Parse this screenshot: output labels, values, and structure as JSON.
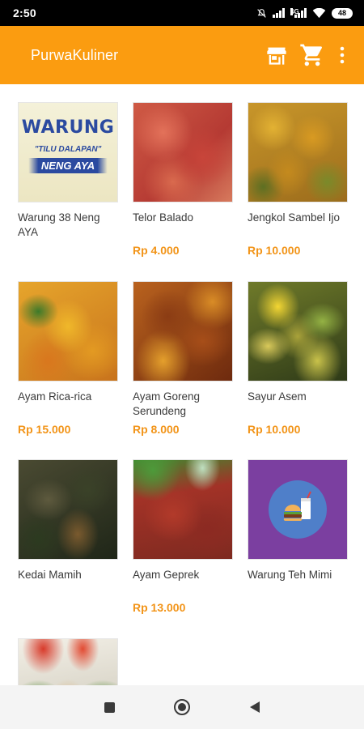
{
  "status_bar": {
    "time": "2:50",
    "network_label": "4G",
    "battery": "48"
  },
  "app_bar": {
    "title": "PurwaKuliner",
    "actions": [
      "store-icon",
      "cart-icon",
      "more-vert-icon"
    ]
  },
  "items": [
    {
      "name": "Warung 38 Neng AYA",
      "price": "",
      "image": "warung-banner",
      "banner_title": "WARUNG",
      "banner_subtitle": "\"TILU DALAPAN\"",
      "banner_name": "NENG AYA"
    },
    {
      "name": "Telor Balado",
      "price": "Rp 4.000",
      "image": "food-photo"
    },
    {
      "name": "Jengkol Sambel Ijo",
      "price": "Rp 10.000",
      "image": "food-photo"
    },
    {
      "name": "Ayam Rica-rica",
      "price": "Rp 15.000",
      "image": "food-photo"
    },
    {
      "name": "Ayam Goreng Serundeng",
      "price": "Rp 8.000",
      "image": "food-photo"
    },
    {
      "name": "Sayur Asem",
      "price": "Rp 10.000",
      "image": "food-photo"
    },
    {
      "name": "Kedai Mamih",
      "price": "",
      "image": "food-photo"
    },
    {
      "name": "Ayam Geprek",
      "price": "Rp 13.000",
      "image": "food-photo"
    },
    {
      "name": "Warung Teh Mimi",
      "price": "",
      "image": "burger-drink-icon"
    },
    {
      "name": "",
      "price": "",
      "image": "food-photo"
    }
  ],
  "colors": {
    "accent": "#fb9c10",
    "price": "#f29418"
  },
  "nav_bar": [
    "recents-square-icon",
    "home-circle-icon",
    "back-triangle-icon"
  ]
}
